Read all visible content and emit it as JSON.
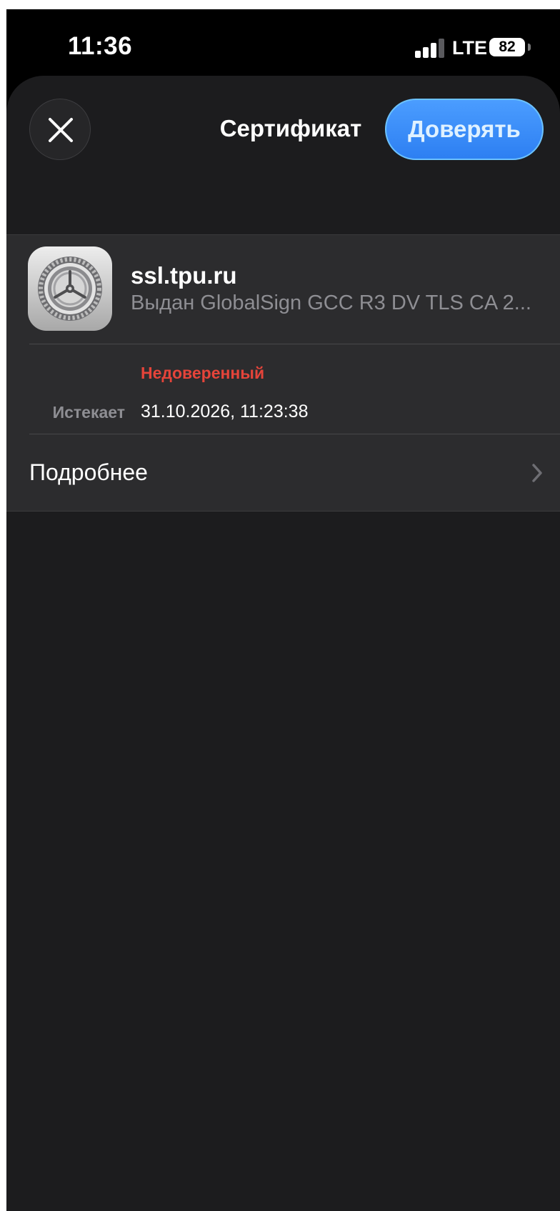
{
  "status_bar": {
    "time": "11:36",
    "network": "LTE",
    "battery": "82"
  },
  "sheet": {
    "title": "Сертификат",
    "close_icon": "close-icon",
    "trust_label": "Доверять"
  },
  "certificate": {
    "icon": "settings-gear-icon",
    "domain": "ssl.tpu.ru",
    "issuer": "Выдан GlobalSign GCC R3 DV TLS CA 2...",
    "status": "Недоверенный",
    "expires_label": "Истекает",
    "expires_value": "31.10.2026, 11:23:38",
    "details_label": "Подробнее"
  },
  "colors": {
    "background": "#1c1c1e",
    "card": "#2c2c2e",
    "accent": "#3a8dff",
    "untrusted": "#e5443a",
    "secondary_text": "#8e8e93"
  }
}
